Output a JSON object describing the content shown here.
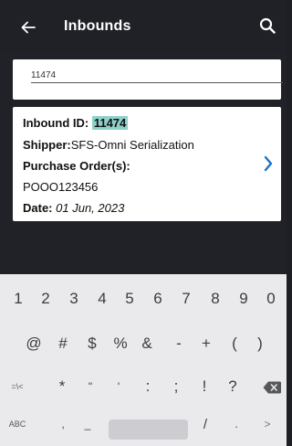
{
  "appbar": {
    "title": "Inbounds",
    "back_icon": "arrow-back-icon",
    "search_icon": "search-icon"
  },
  "search": {
    "value": "11474"
  },
  "card": {
    "inbound_label": "Inbound ID:",
    "inbound_value": "11474",
    "shipper_label": "Shipper:",
    "shipper_value": "SFS-Omni Serialization",
    "po_label": "Purchase Order(s):",
    "po_value": "POOO123456",
    "date_label": "Date:",
    "date_value": "01 Jun, 2023",
    "chevron_icon": "chevron-right-icon"
  },
  "keyboard": {
    "row1": [
      "1",
      "2",
      "3",
      "4",
      "5",
      "6",
      "7",
      "8",
      "9",
      "0"
    ],
    "row2": [
      "@",
      "#",
      "$",
      "%",
      "&",
      "-",
      "+",
      "(",
      ")"
    ],
    "row3": [
      "=\\<",
      "*",
      "\"",
      "'",
      ":",
      ";",
      "!",
      "?"
    ],
    "row4": {
      "abc": "ABC",
      "comma": ",",
      "underscore": "_",
      "slash": "/",
      "period": ".",
      "next": ">"
    },
    "backspace_icon": "backspace-icon"
  },
  "colors": {
    "appbar": "#1f2127",
    "highlight": "#8fd1c9",
    "chevron": "#1a73c7",
    "keyboard": "#eaeaec"
  }
}
